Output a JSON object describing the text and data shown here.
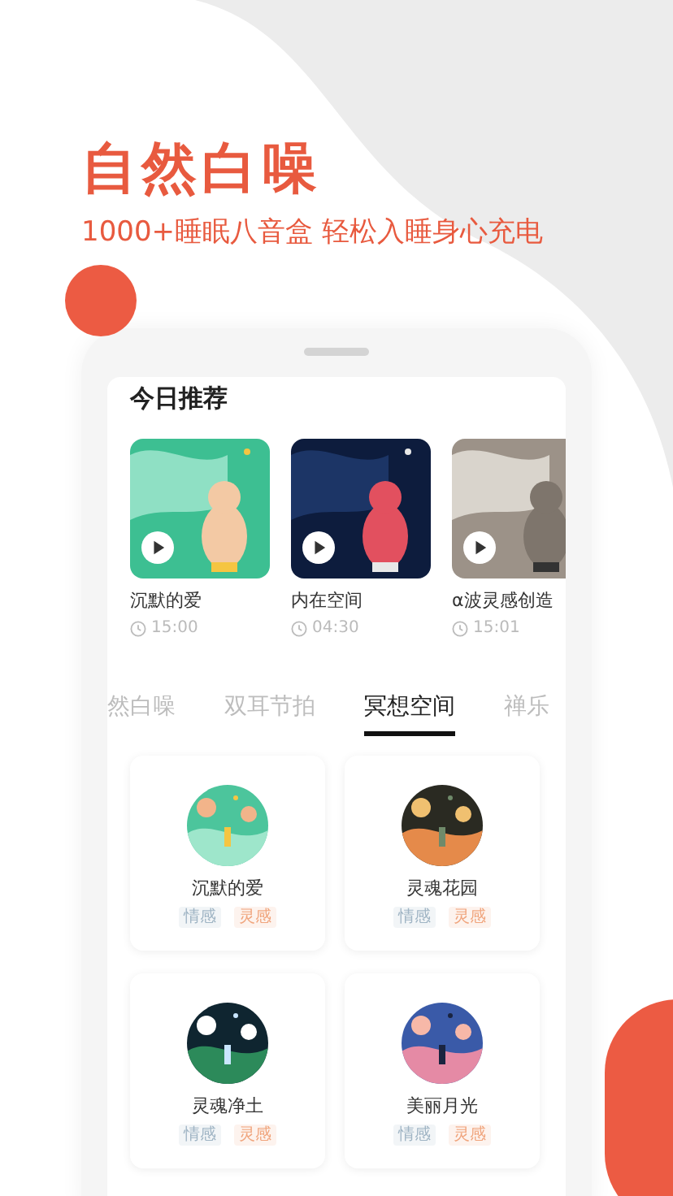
{
  "headline": "自然白噪",
  "subtitle": "1000+睡眠八音盒 轻松入睡身心充电",
  "section_title": "今日推荐",
  "recommendations": [
    {
      "kind": "picture",
      "title": "沉默的爱",
      "duration": "15:00"
    },
    {
      "kind": "picture",
      "title": "内在空间",
      "duration": "04:30"
    },
    {
      "kind": "picture",
      "title": "α波灵感创造",
      "duration": "15:01"
    }
  ],
  "tabs": [
    {
      "label": "然白噪",
      "selected": false
    },
    {
      "label": "双耳节拍",
      "selected": false
    },
    {
      "label": "冥想空间",
      "selected": true
    },
    {
      "label": "禅乐",
      "selected": false
    }
  ],
  "albums": [
    {
      "kind": "picture",
      "title": "沉默的爱",
      "tags": [
        {
          "label": "情感",
          "color": "#9fb4c4"
        },
        {
          "label": "灵感",
          "color": "#f0a47c"
        }
      ]
    },
    {
      "kind": "picture",
      "title": "灵魂花园",
      "tags": [
        {
          "label": "情感",
          "color": "#9fb4c4"
        },
        {
          "label": "灵感",
          "color": "#f0a47c"
        }
      ]
    },
    {
      "kind": "picture",
      "title": "灵魂净土",
      "tags": [
        {
          "label": "情感",
          "color": "#9fb4c4"
        },
        {
          "label": "灵感",
          "color": "#f0a47c"
        }
      ]
    },
    {
      "kind": "picture",
      "title": "美丽月光",
      "tags": [
        {
          "label": "情感",
          "color": "#9fb4c4"
        },
        {
          "label": "灵感",
          "color": "#f0a47c"
        }
      ]
    }
  ]
}
